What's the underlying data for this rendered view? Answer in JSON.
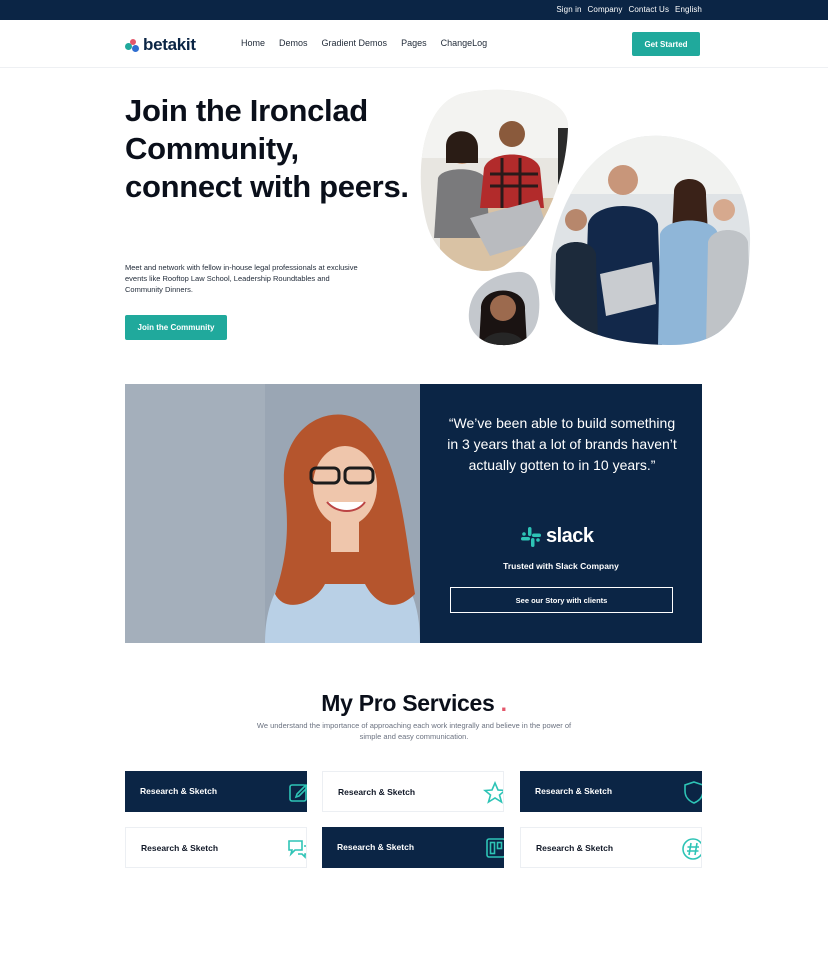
{
  "topbar": {
    "links": [
      "Sign in",
      "Company",
      "Contact Us",
      "English"
    ]
  },
  "nav": {
    "logo_text": "betakit",
    "menu": [
      "Home",
      "Demos",
      "Gradient Demos",
      "Pages",
      "ChangeLog"
    ],
    "cta_label": "Get Started"
  },
  "hero": {
    "title": "Join the Ironclad Community, connect with peers.",
    "description": "Meet and network with fellow in-house legal professionals at exclusive events like Rooftop Law School, Leadership Roundtables and Community Dinners.",
    "button_label": "Join the Community"
  },
  "testimonial": {
    "quote": "“We’ve been able to build something in 3 years that a lot of brands haven’t actually gotten to in 10 years.”",
    "brand_word": "slack",
    "trusted_text": "Trusted with Slack Company",
    "button_label": "See our Story with clients"
  },
  "services": {
    "title": "My Pro Services",
    "title_dot": ".",
    "subtitle": "We understand the importance of approaching each work integrally and believe in the power of simple and easy communication.",
    "cards": [
      {
        "label": "Research & Sketch",
        "theme": "dark",
        "icon": "edit-icon"
      },
      {
        "label": "Research & Sketch",
        "theme": "light",
        "icon": "star-icon"
      },
      {
        "label": "Research & Sketch",
        "theme": "dark",
        "icon": "shield-icon"
      },
      {
        "label": "Research & Sketch",
        "theme": "light",
        "icon": "chat-icon"
      },
      {
        "label": "Research & Sketch",
        "theme": "dark",
        "icon": "board-icon"
      },
      {
        "label": "Research & Sketch",
        "theme": "light",
        "icon": "hashtag-icon"
      }
    ]
  },
  "colors": {
    "navy": "#0b2545",
    "teal": "#20a99c",
    "accent_dot": "#e4576b"
  }
}
